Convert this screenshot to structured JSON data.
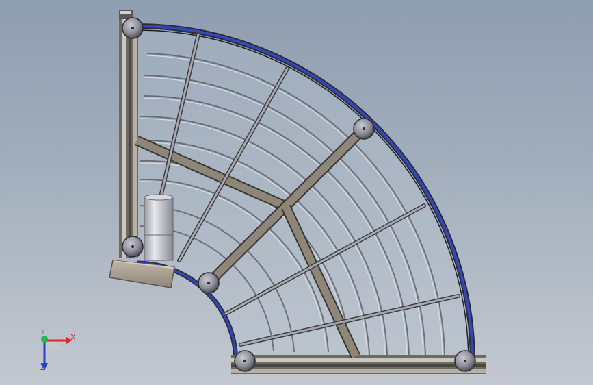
{
  "triad": {
    "x_label": "X",
    "y_label": "Y",
    "z_label": "Z",
    "x_color": "#e0262a",
    "y_color": "#2db34a",
    "z_color": "#2a3fc8"
  },
  "colors": {
    "background_top": "#8e9db0",
    "background_bottom": "#c3c8d0",
    "frame": "#7d7568",
    "belt_edge": "#3348b8",
    "joint_ball": "#8f909a",
    "motor_housing": "#a79d92",
    "motor_cylinder": "#c4c4cc"
  }
}
